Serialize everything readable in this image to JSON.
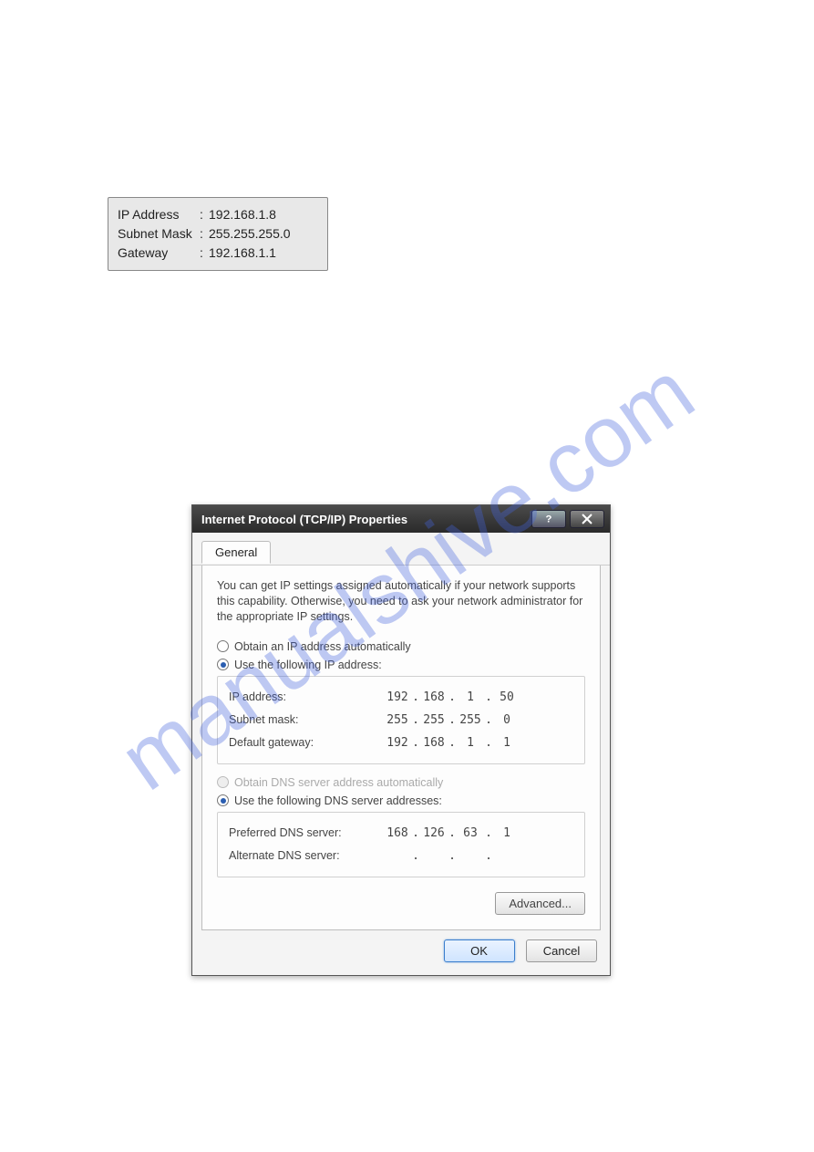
{
  "watermark": "manualshive.com",
  "infobox": {
    "ip_label": "IP Address",
    "ip_value": "192.168.1.8",
    "mask_label": "Subnet Mask",
    "mask_value": "255.255.255.0",
    "gw_label": "Gateway",
    "gw_value": "192.168.1.1"
  },
  "dialog": {
    "title": "Internet Protocol (TCP/IP) Properties",
    "tab_general": "General",
    "description": "You can get IP settings assigned automatically if your network supports this capability. Otherwise, you need to ask your network administrator for the appropriate IP settings.",
    "obtain_ip": "Obtain an IP address automatically",
    "use_ip": "Use the following IP address:",
    "ip_address_label": "IP address:",
    "ip_address": {
      "a": "192",
      "b": "168",
      "c": "1",
      "d": "50"
    },
    "subnet_label": "Subnet mask:",
    "subnet": {
      "a": "255",
      "b": "255",
      "c": "255",
      "d": "0"
    },
    "gateway_label": "Default gateway:",
    "gateway": {
      "a": "192",
      "b": "168",
      "c": "1",
      "d": "1"
    },
    "obtain_dns": "Obtain DNS server address automatically",
    "use_dns": "Use the following DNS server addresses:",
    "pref_dns_label": "Preferred DNS server:",
    "pref_dns": {
      "a": "168",
      "b": "126",
      "c": "63",
      "d": "1"
    },
    "alt_dns_label": "Alternate DNS server:",
    "alt_dns": {
      "a": "",
      "b": "",
      "c": "",
      "d": ""
    },
    "advanced": "Advanced...",
    "ok": "OK",
    "cancel": "Cancel"
  }
}
